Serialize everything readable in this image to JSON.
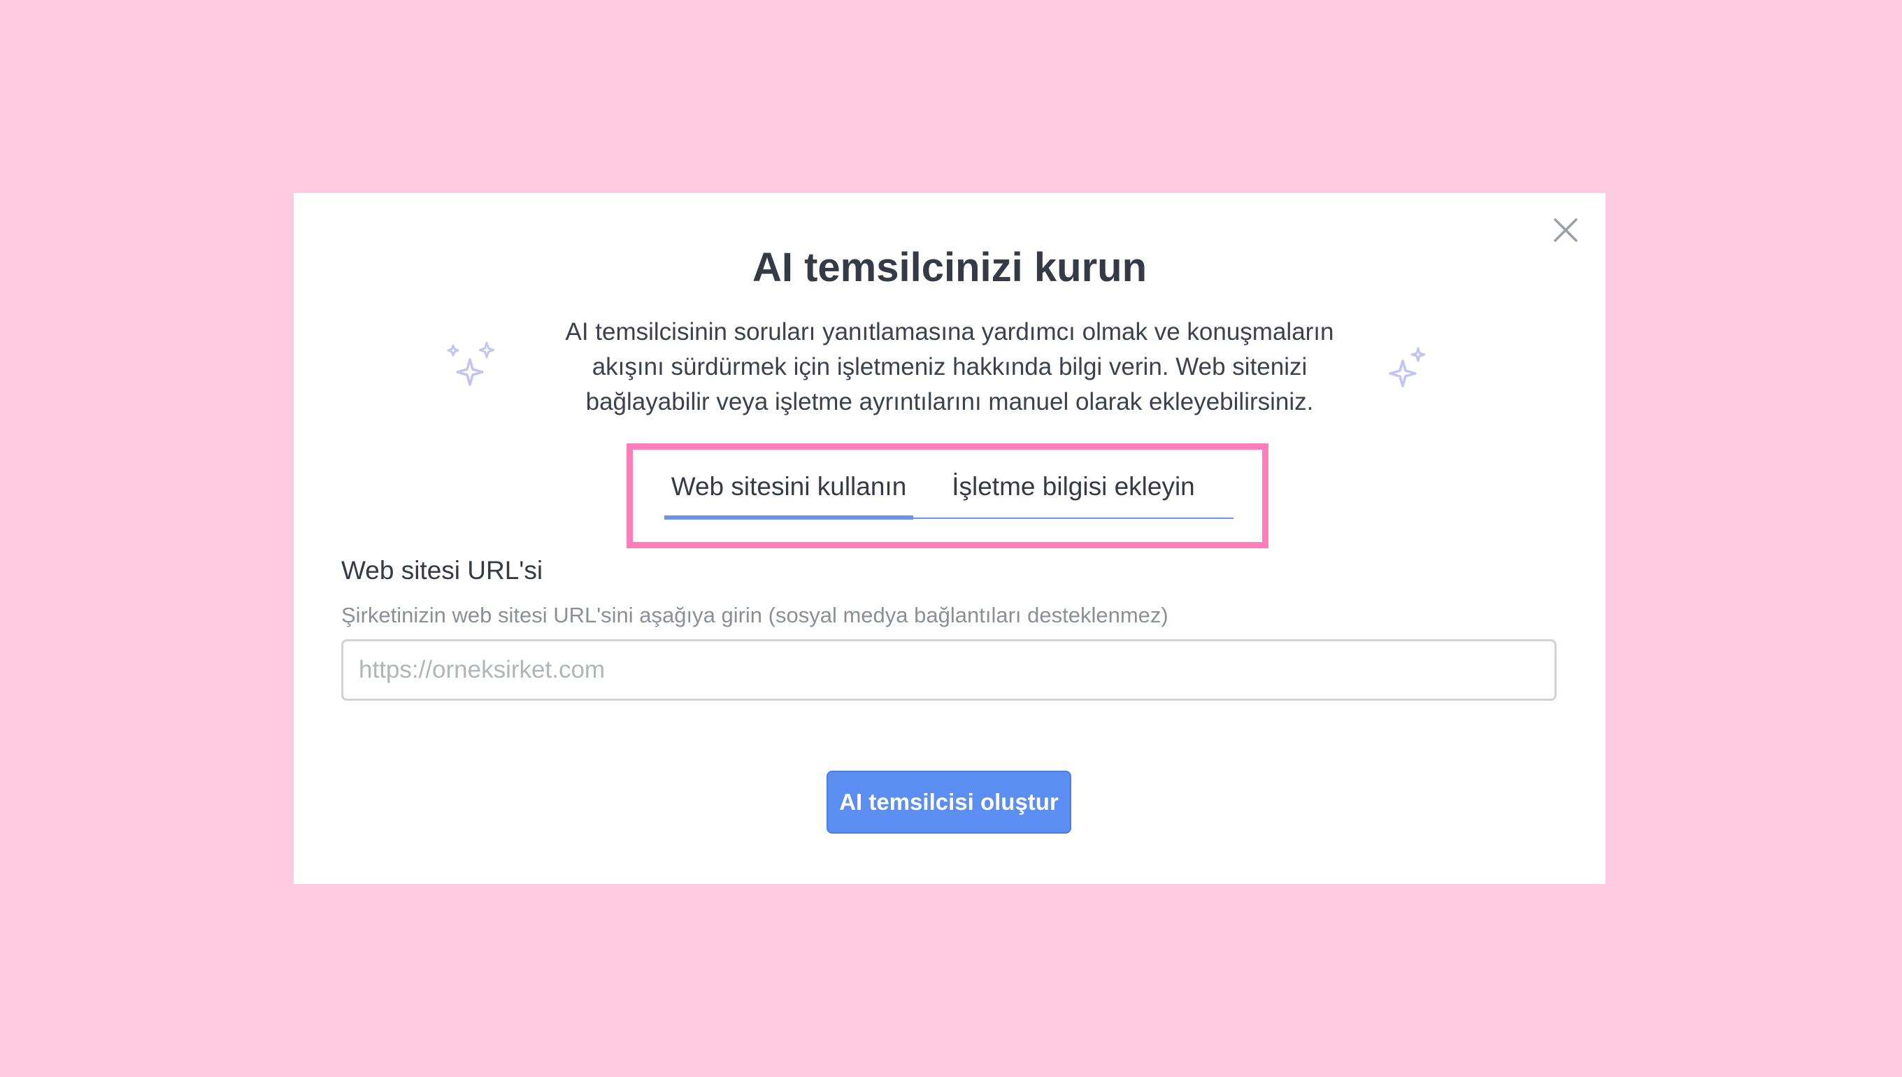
{
  "dialog": {
    "title": "AI temsilcinizi kurun",
    "description": "AI temsilcisinin soruları yanıtlamasına yardımcı olmak ve konuşmaların akışını sürdürmek için işletmeniz hakkında bilgi verin. Web sitenizi bağlayabilir veya işletme ayrıntılarını manuel olarak ekleyebilirsiniz.",
    "close_icon": "close-icon",
    "decorations": [
      "sparkle-icon",
      "sparkle-icon"
    ]
  },
  "tabs": [
    {
      "label": "Web sitesini kullanın",
      "active": true
    },
    {
      "label": "İşletme bilgisi ekleyin",
      "active": false
    }
  ],
  "form": {
    "url_label": "Web sitesi URL'si",
    "url_help": "Şirketinizin web sitesi URL'sini aşağıya girin (sosyal medya bağlantıları desteklenmez)",
    "url_placeholder": "https://orneksirket.com",
    "url_value": ""
  },
  "actions": {
    "create_label": "AI temsilcisi oluştur"
  },
  "colors": {
    "background": "#ffcbe0",
    "accent": "#5b8ef0",
    "highlight": "#ff7eb9",
    "sparkle": "#c5c8f5"
  }
}
